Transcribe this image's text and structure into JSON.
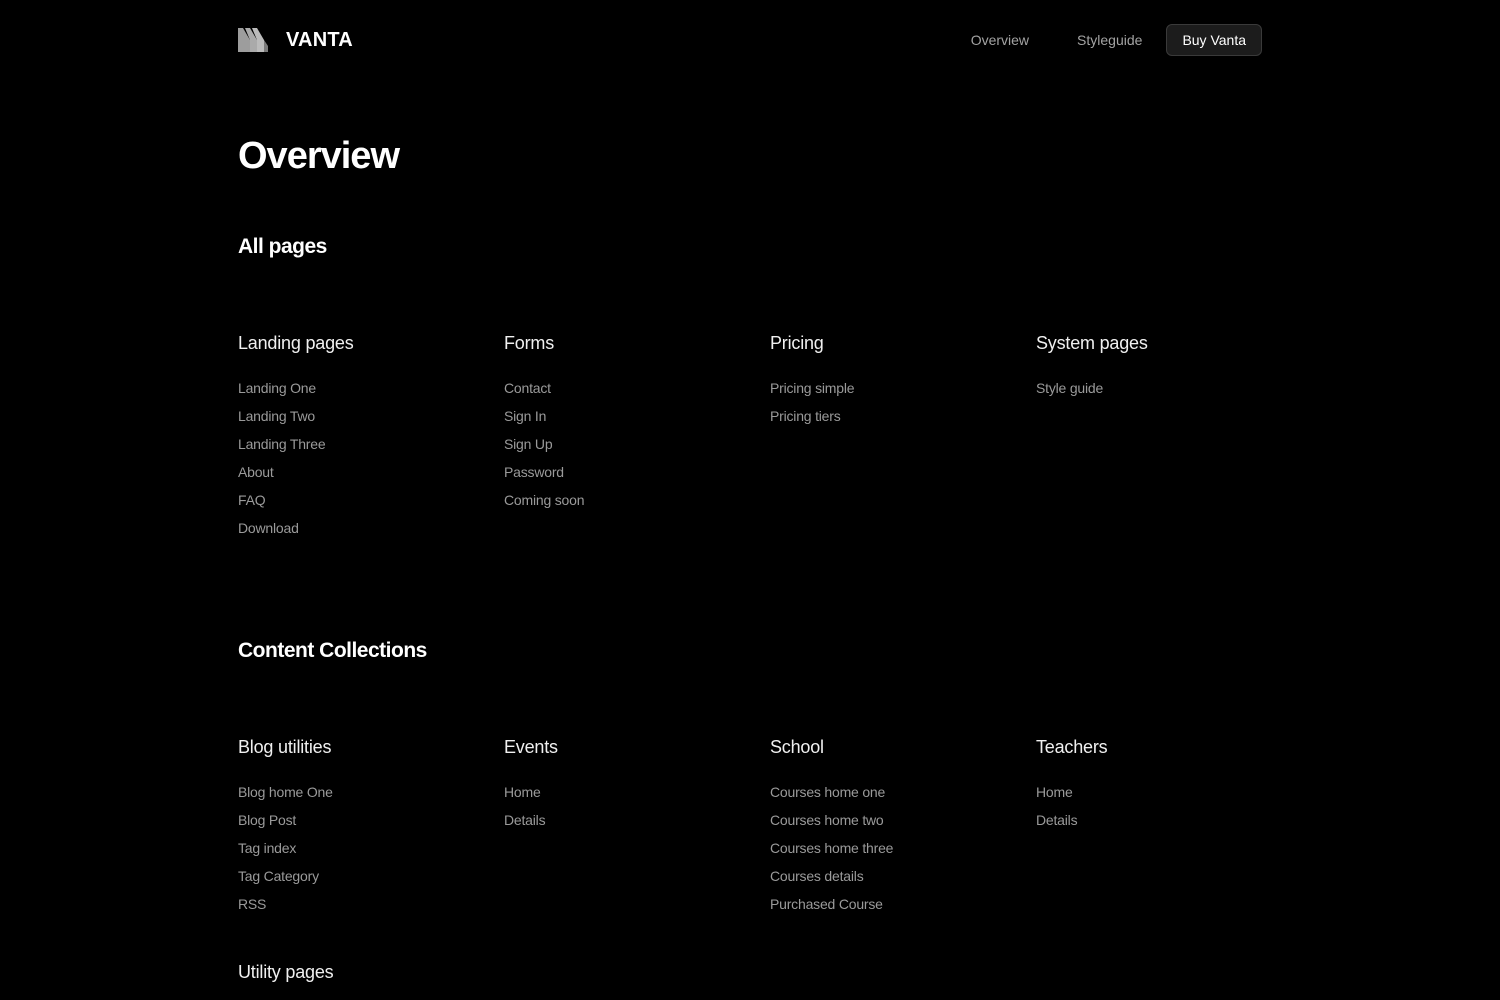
{
  "header": {
    "brand_name": "VANTA",
    "logo_icon": "vanta-logo-icon",
    "nav": {
      "overview": "Overview",
      "styleguide": "Styleguide",
      "buy": "Buy Vanta"
    }
  },
  "colors": {
    "background": "#000000",
    "text_primary": "#ffffff",
    "text_muted": "#9a9a9a",
    "button_bg": "#1c1c1c",
    "button_border": "#3a3a3a"
  },
  "page_title": "Overview",
  "all_pages": {
    "title": "All pages",
    "groups": [
      {
        "title": "Landing pages",
        "links": [
          "Landing One",
          "Landing Two",
          "Landing Three",
          "About",
          "FAQ",
          "Download"
        ]
      },
      {
        "title": "Forms",
        "links": [
          "Contact",
          "Sign In",
          "Sign Up",
          "Password",
          "Coming soon"
        ]
      },
      {
        "title": "Pricing",
        "links": [
          "Pricing simple",
          "Pricing tiers"
        ]
      },
      {
        "title": "System pages",
        "links": [
          "Style guide"
        ]
      }
    ]
  },
  "content_collections": {
    "title": "Content Collections",
    "groups": [
      {
        "title": "Blog utilities",
        "links": [
          "Blog home One",
          "Blog Post",
          "Tag index",
          "Tag Category",
          "RSS"
        ]
      },
      {
        "title": "Events",
        "links": [
          "Home",
          "Details"
        ]
      },
      {
        "title": "School",
        "links": [
          "Courses home one",
          "Courses home two",
          "Courses home three",
          "Courses details",
          "Purchased Course"
        ]
      },
      {
        "title": "Teachers",
        "links": [
          "Home",
          "Details"
        ]
      }
    ]
  },
  "utility_pages": {
    "title": "Utility pages"
  }
}
